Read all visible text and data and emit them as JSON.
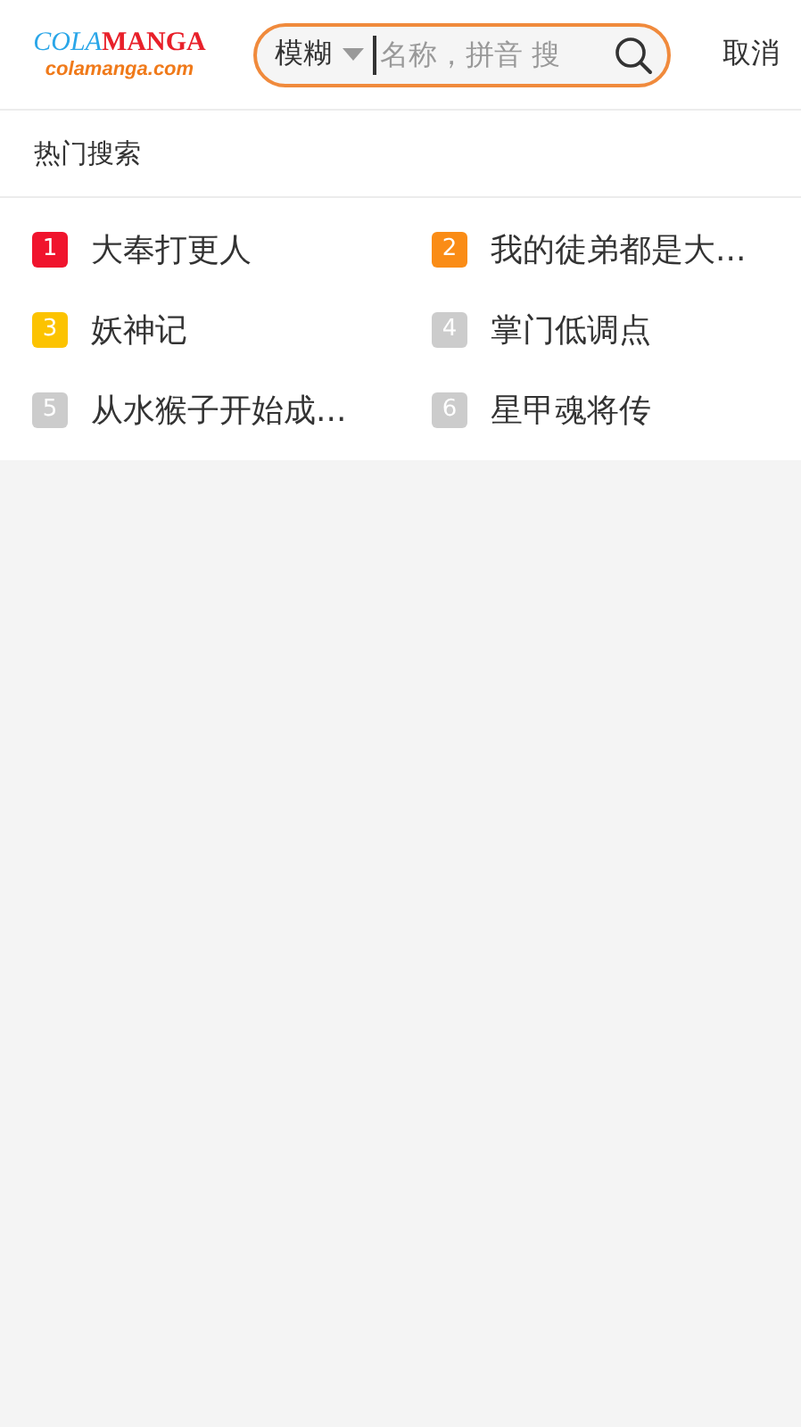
{
  "header": {
    "logo": {
      "first": "COLA",
      "second": "MANGA",
      "subtitle": "colamanga.com"
    },
    "search": {
      "mode": "模糊",
      "placeholder": "名称，拼音 搜"
    },
    "cancel": "取消"
  },
  "hot_search": {
    "title": "热门搜索",
    "items": [
      {
        "rank": "1",
        "title": "大奉打更人",
        "color": "#f0142d"
      },
      {
        "rank": "2",
        "title": "我的徒弟都是大...",
        "color": "#fa8c16"
      },
      {
        "rank": "3",
        "title": "妖神记",
        "color": "#fcc300"
      },
      {
        "rank": "4",
        "title": "掌门低调点",
        "color": "#cccccc"
      },
      {
        "rank": "5",
        "title": "从水猴子开始成...",
        "color": "#cccccc"
      },
      {
        "rank": "6",
        "title": "星甲魂将传",
        "color": "#cccccc"
      }
    ]
  }
}
